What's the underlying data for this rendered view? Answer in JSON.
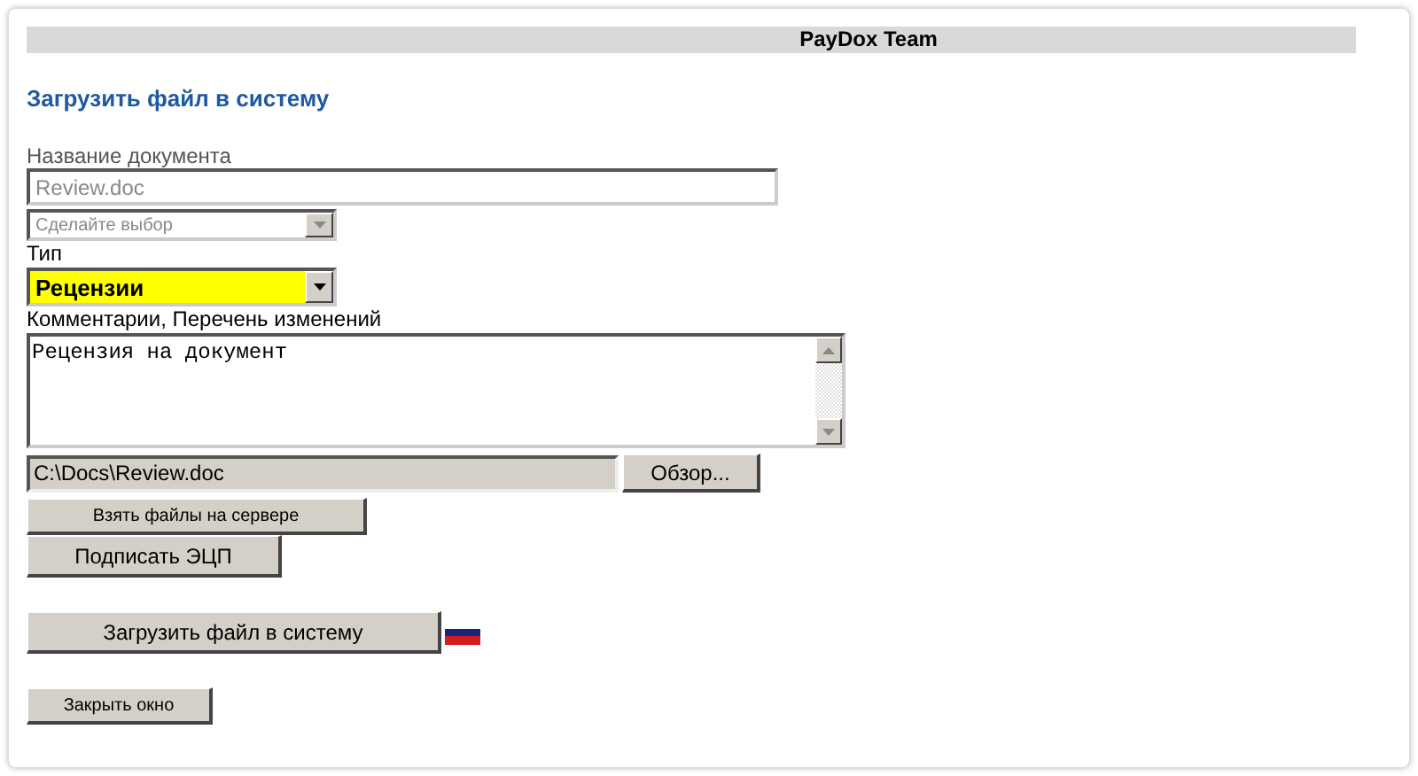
{
  "header": {
    "title": "PayDox Team"
  },
  "heading": "Загрузить файл в систему",
  "name_field": {
    "label": "Название документа",
    "value": "Review.doc",
    "disabled": true
  },
  "choice_select": {
    "value": "Сделайте выбор",
    "disabled": true
  },
  "type_select": {
    "label": "Тип",
    "value": "Рецензии",
    "disabled": false
  },
  "comments": {
    "label": "Комментарии, Перечень изменений",
    "value": "Рецензия на документ"
  },
  "file_field": {
    "value": "C:\\Docs\\Review.doc"
  },
  "browse_button": "Обзор...",
  "server_button": "Взять файлы на сервере",
  "sign_button": "Подписать ЭЦП",
  "upload_button": "Загрузить файл в систему",
  "close_button": "Закрыть окно"
}
